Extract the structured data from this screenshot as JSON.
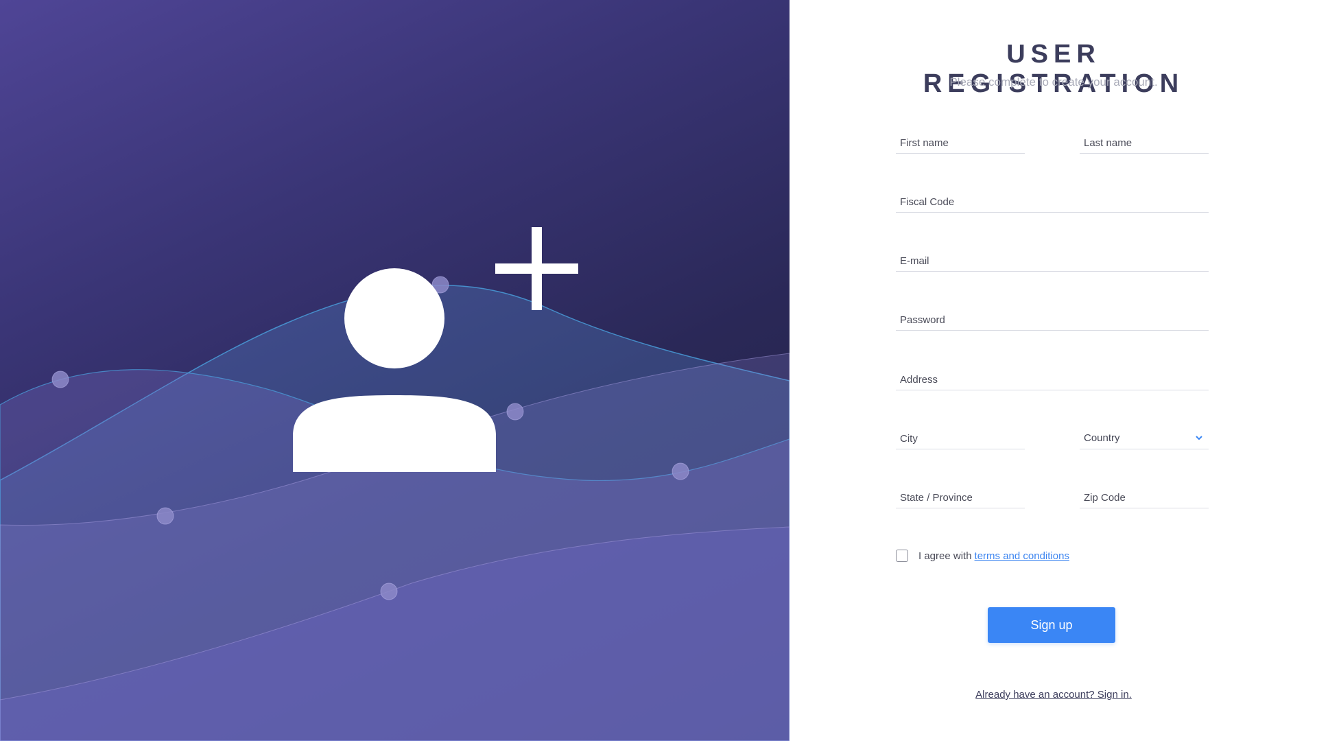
{
  "hero": {
    "icons": {
      "user": "user-silhouette-icon",
      "plus": "plus-icon"
    },
    "colors": {
      "bg_top": "#4f4596",
      "bg_bottom": "#1f2040",
      "wave_blue": "#5a8fd6",
      "wave_purple": "#7c72c7"
    }
  },
  "form": {
    "title": "USER REGISTRATION",
    "subtitle": "Please complete to create your account.",
    "fields": {
      "first_name": "First name",
      "last_name": "Last name",
      "fiscal_code": "Fiscal Code",
      "email": "E-mail",
      "password": "Password",
      "address": "Address",
      "city": "City",
      "country": "Country",
      "state": "State / Province",
      "zip": "Zip Code"
    },
    "agree_text": "I agree with",
    "terms_link": "terms and conditions",
    "signup_label": "Sign up",
    "signin_link": "Already have an account? Sign in.",
    "colors": {
      "title": "#3c3d5c",
      "accent": "#3a86f5",
      "link": "#3b84f0"
    }
  }
}
